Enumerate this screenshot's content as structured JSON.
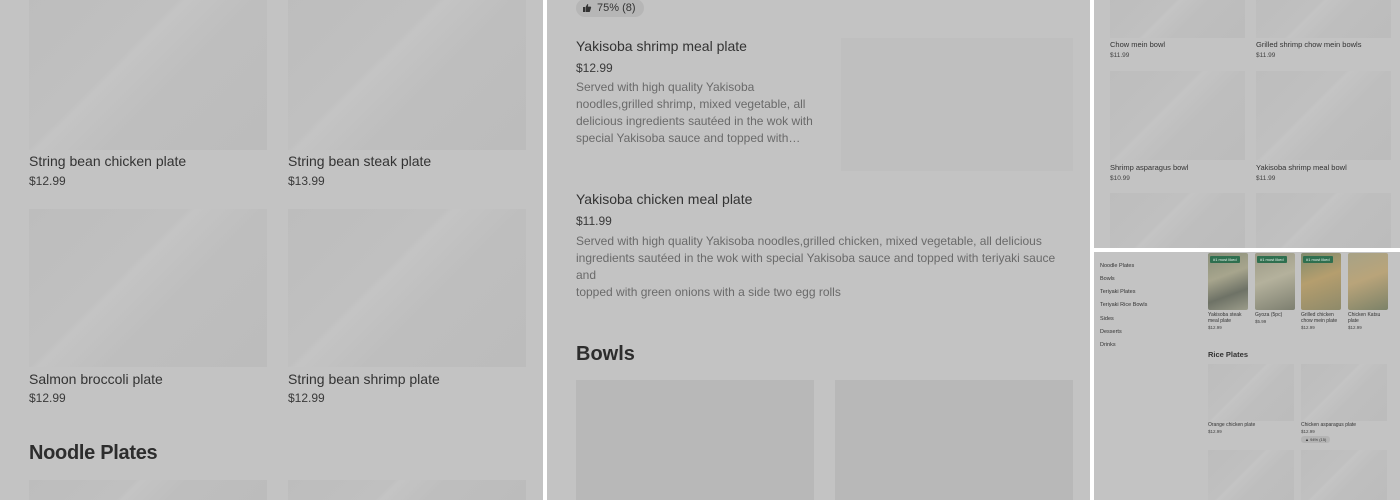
{
  "panel1": {
    "items": [
      {
        "name": "String bean chicken plate",
        "price": "$12.99"
      },
      {
        "name": "String bean steak plate",
        "price": "$13.99"
      },
      {
        "name": "Salmon broccoli plate",
        "price": "$12.99"
      },
      {
        "name": "String bean shrimp plate",
        "price": "$12.99"
      }
    ],
    "section_heading": "Noodle Plates"
  },
  "panel2": {
    "rating_badge": "75% (8)",
    "items": [
      {
        "name": "Yakisoba shrimp meal plate",
        "price": "$12.99",
        "description": "Served with high quality Yakisoba noodles,grilled shrimp, mixed vegetable, all delicious ingredients sautéed in the wok with special Yakisoba sauce and topped with…"
      },
      {
        "name": "Yakisoba chicken meal plate",
        "price": "$11.99",
        "description_line1": "Served with high quality Yakisoba noodles,grilled chicken, mixed vegetable, all delicious",
        "description_line2": "ingredients sautéed in the wok with special Yakisoba sauce and topped with teriyaki sauce",
        "description_line3": "and",
        "description_line4": "topped with green onions with a side two egg rolls"
      }
    ],
    "section_heading": "Bowls"
  },
  "panel3": {
    "items": [
      {
        "name": "Chow mein bowl",
        "price": "$11.99"
      },
      {
        "name": "Grilled shrimp chow mein bowls",
        "price": "$11.99"
      },
      {
        "name": "Shrimp asparagus bowl",
        "price": "$10.99"
      },
      {
        "name": "Yakisoba shrimp meal bowl",
        "price": "$11.99"
      }
    ]
  },
  "panel4": {
    "sidebar": [
      "Noodle Plates",
      "Bowls",
      "Teriyaki Plates",
      "Teriyaki Rice Bowls",
      "Sides",
      "Desserts",
      "Drinks"
    ],
    "featured_tag": "#1 most liked",
    "featured": [
      {
        "name_line1": "Yakisoba steak",
        "name_line2": "meal plate",
        "price": "$12.99"
      },
      {
        "name_line1": "Gyoza (5pc)",
        "name_line2": "",
        "price": "$5.99"
      },
      {
        "name_line1": "Grilled chicken",
        "name_line2": "chow mein plate",
        "price": "$12.99"
      },
      {
        "name_line1": "Chicken Katsu",
        "name_line2": "plate",
        "price": "$12.99"
      }
    ],
    "section_heading": "Rice Plates",
    "rice_items": [
      {
        "name": "Orange chicken plate",
        "price": "$12.99"
      },
      {
        "name": "Chicken asparagus plate",
        "price": "$12.99"
      }
    ],
    "rice_badge": "94% (15)"
  },
  "icons": {
    "thumbs_up": "thumbs-up-icon"
  }
}
